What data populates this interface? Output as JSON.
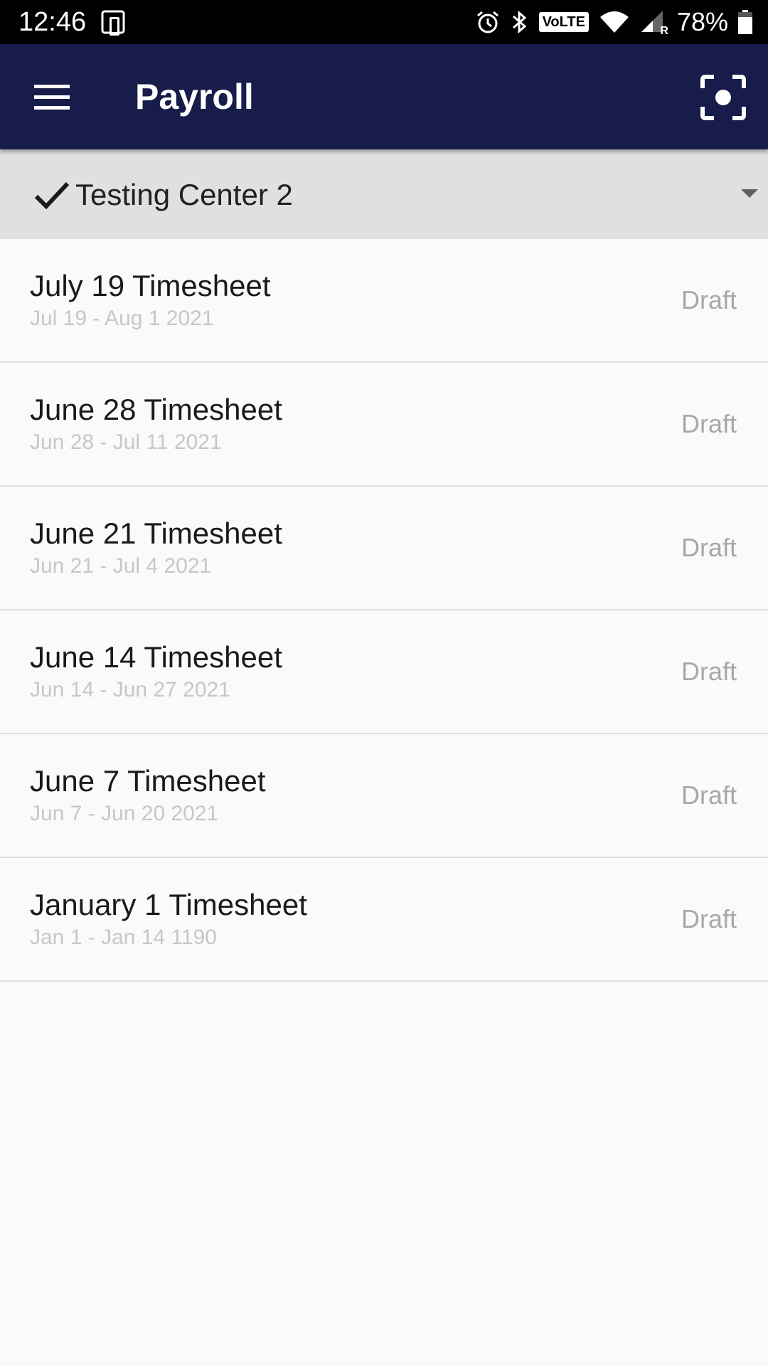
{
  "status_bar": {
    "time": "12:46",
    "battery_percent": "78%",
    "battery_level": 0.78,
    "volte_label": "VoLTE",
    "roaming_label": "R",
    "icons": [
      "phone-sync-icon",
      "alarm-icon",
      "bluetooth-icon",
      "volte-icon",
      "wifi-icon",
      "signal-icon",
      "battery-icon"
    ]
  },
  "app_bar": {
    "title": "Payroll",
    "background": "#171c4b",
    "icons": [
      "menu-icon",
      "scan-icon"
    ]
  },
  "selector": {
    "selected_value": "Testing Center 2",
    "icons": [
      "check-icon",
      "dropdown-caret-icon"
    ]
  },
  "timesheets": [
    {
      "title": "July 19 Timesheet",
      "range": "Jul 19 - Aug 1 2021",
      "status": "Draft"
    },
    {
      "title": "June 28 Timesheet",
      "range": "Jun 28 - Jul 11 2021",
      "status": "Draft"
    },
    {
      "title": "June 21 Timesheet",
      "range": "Jun 21 - Jul 4 2021",
      "status": "Draft"
    },
    {
      "title": "June 14 Timesheet",
      "range": "Jun 14 - Jun 27 2021",
      "status": "Draft"
    },
    {
      "title": "June 7 Timesheet",
      "range": "Jun 7 - Jun 20 2021",
      "status": "Draft"
    },
    {
      "title": "January 1 Timesheet",
      "range": "Jan 1 - Jan 14 1190",
      "status": "Draft"
    }
  ]
}
